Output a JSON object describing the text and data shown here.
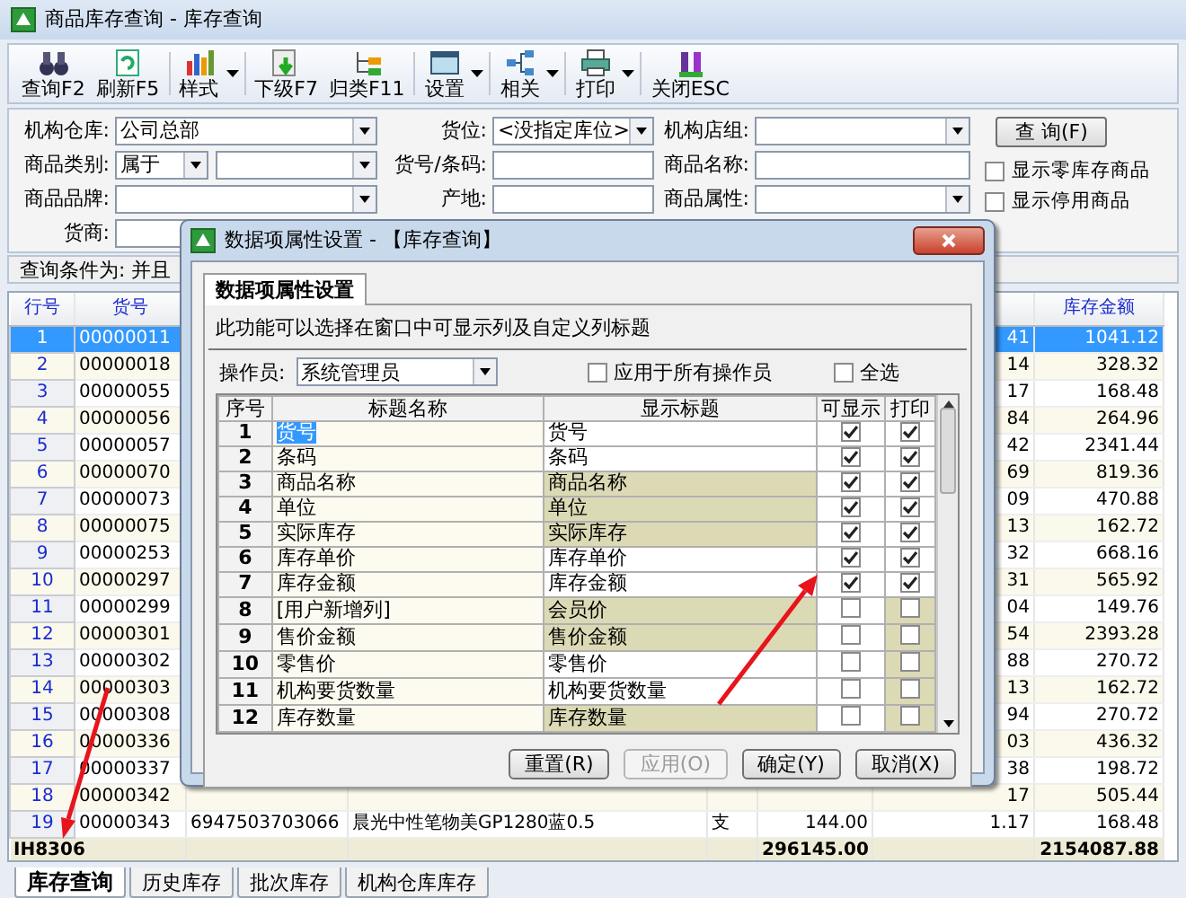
{
  "window": {
    "title": "商品库存查询 - 库存查询"
  },
  "toolbar": [
    {
      "label": "查询F2",
      "has_menu": false
    },
    {
      "label": "刷新F5",
      "has_menu": false
    },
    {
      "label": "样式",
      "has_menu": true
    },
    {
      "label": "下级F7",
      "has_menu": false
    },
    {
      "label": "归类F11",
      "has_menu": false
    },
    {
      "label": "设置",
      "has_menu": true
    },
    {
      "label": "相关",
      "has_menu": true
    },
    {
      "label": "打印",
      "has_menu": true
    },
    {
      "label": "关闭ESC",
      "has_menu": false
    }
  ],
  "filters": [
    {
      "label": "机构仓库:",
      "kind": "select",
      "value": "公司总部"
    },
    {
      "label": "货位:",
      "kind": "select",
      "value": "<没指定库位>"
    },
    {
      "label": "机构店组:",
      "kind": "select"
    },
    {
      "label": "商品类别:",
      "kind": "split",
      "value": "属于"
    },
    {
      "label": "货号/条码:",
      "kind": "input"
    },
    {
      "label": "商品名称:",
      "kind": "input"
    },
    {
      "label": "商品品牌:",
      "kind": "select"
    },
    {
      "label": "产地:",
      "kind": "input"
    },
    {
      "label": "商品属性:",
      "kind": "select"
    },
    {
      "label": "货商:",
      "kind": "lookup"
    }
  ],
  "query_button": "查 询(F)",
  "options": [
    {
      "label": "显示零库存商品",
      "checked": false
    },
    {
      "label": "显示停用商品",
      "checked": false
    }
  ],
  "condition": "查询条件为: 并且",
  "table": {
    "headers": {
      "row": "行号",
      "code": "货号",
      "amount": "库存金额"
    },
    "rows": [
      {
        "row": "1",
        "code": "00000011",
        "column_7": "41",
        "amount": "1041.12",
        "selected": true
      },
      {
        "row": "2",
        "code": "00000018",
        "column_7": "14",
        "amount": "328.32",
        "selected": false
      },
      {
        "row": "3",
        "code": "00000055",
        "column_7": "17",
        "amount": "168.48",
        "selected": false
      },
      {
        "row": "4",
        "code": "00000056",
        "column_7": "84",
        "amount": "264.96",
        "selected": false
      },
      {
        "row": "5",
        "code": "00000057",
        "column_7": "42",
        "amount": "2341.44",
        "selected": false
      },
      {
        "row": "6",
        "code": "00000070",
        "column_7": "69",
        "amount": "819.36",
        "selected": false
      },
      {
        "row": "7",
        "code": "00000073",
        "column_7": "09",
        "amount": "470.88",
        "selected": false
      },
      {
        "row": "8",
        "code": "00000075",
        "column_7": "13",
        "amount": "162.72",
        "selected": false
      },
      {
        "row": "9",
        "code": "00000253",
        "column_7": "32",
        "amount": "668.16",
        "selected": false
      },
      {
        "row": "10",
        "code": "00000297",
        "column_7": "31",
        "amount": "565.92",
        "selected": false
      },
      {
        "row": "11",
        "code": "00000299",
        "column_7": "04",
        "amount": "149.76",
        "selected": false
      },
      {
        "row": "12",
        "code": "00000301",
        "column_7": "54",
        "amount": "2393.28",
        "selected": false
      },
      {
        "row": "13",
        "code": "00000302",
        "column_7": "88",
        "amount": "270.72",
        "selected": false
      },
      {
        "row": "14",
        "code": "00000303",
        "column_7": "13",
        "amount": "162.72",
        "selected": false
      },
      {
        "row": "15",
        "code": "00000308",
        "column_7": "94",
        "amount": "270.72",
        "selected": false
      },
      {
        "row": "16",
        "code": "00000336",
        "column_7": "03",
        "amount": "436.32",
        "selected": false
      },
      {
        "row": "17",
        "code": "00000337",
        "column_7": "38",
        "amount": "198.72",
        "selected": false
      },
      {
        "row": "18",
        "code": "00000342",
        "column_7": "17",
        "amount": "505.44",
        "selected": false
      },
      {
        "row": "19",
        "code": "00000343",
        "barcode": "6947503703066",
        "name": "晨光中性笔物美GP1280蓝0.5",
        "unit": "支",
        "stock": "144.00",
        "column_7": "1.17",
        "amount": "168.48",
        "selected": false
      }
    ],
    "footer": {
      "label": "IH8306",
      "stock": "296145.00",
      "amount": "2154087.88"
    }
  },
  "bottom_tabs": [
    {
      "label": "库存查询",
      "selected": true
    },
    {
      "label": "历史库存",
      "selected": false
    },
    {
      "label": "批次库存",
      "selected": false
    },
    {
      "label": "机构仓库库存",
      "selected": false
    }
  ],
  "dialog": {
    "title": "数据项属性设置 - 【库存查询】",
    "tab": "数据项属性设置",
    "description": "此功能可以选择在窗口中可显示列及自定义列标题",
    "operator": {
      "label": "操作员:",
      "value": "系统管理员"
    },
    "options": [
      {
        "label": "应用于所有操作员",
        "checked": false
      },
      {
        "label": "全选",
        "checked": false
      }
    ],
    "columns": [
      "序号",
      "标题名称",
      "显示标题",
      "可显示",
      "打印"
    ],
    "rows": [
      {
        "index": "1",
        "title": "货号",
        "display": "货号",
        "visible": true,
        "print": true,
        "selected": true,
        "shaded": false
      },
      {
        "index": "2",
        "title": "条码",
        "display": "条码",
        "visible": true,
        "print": true,
        "selected": false,
        "shaded": false
      },
      {
        "index": "3",
        "title": "商品名称",
        "display": "商品名称",
        "visible": true,
        "print": true,
        "selected": false,
        "shaded": true
      },
      {
        "index": "4",
        "title": "单位",
        "display": "单位",
        "visible": true,
        "print": true,
        "selected": false,
        "shaded": true
      },
      {
        "index": "5",
        "title": "实际库存",
        "display": "实际库存",
        "visible": true,
        "print": true,
        "selected": false,
        "shaded": true
      },
      {
        "index": "6",
        "title": "库存单价",
        "display": "库存单价",
        "visible": true,
        "print": true,
        "selected": false,
        "shaded": false
      },
      {
        "index": "7",
        "title": "库存金额",
        "display": "库存金额",
        "visible": true,
        "print": true,
        "selected": false,
        "shaded": false
      },
      {
        "index": "8",
        "title": "[用户新增列]",
        "display": "会员价",
        "visible": false,
        "print": false,
        "selected": false,
        "shaded": true
      },
      {
        "index": "9",
        "title": "售价金额",
        "display": "售价金额",
        "visible": false,
        "print": false,
        "selected": false,
        "shaded": true
      },
      {
        "index": "10",
        "title": "零售价",
        "display": "零售价",
        "visible": false,
        "print": false,
        "selected": false,
        "shaded": false
      },
      {
        "index": "11",
        "title": "机构要货数量",
        "display": "机构要货数量",
        "visible": false,
        "print": false,
        "selected": false,
        "shaded": false
      },
      {
        "index": "12",
        "title": "库存数量",
        "display": "库存数量",
        "visible": false,
        "print": false,
        "selected": false,
        "shaded": true
      }
    ],
    "buttons": [
      {
        "label": "重置(R)",
        "disabled": false
      },
      {
        "label": "应用(O)",
        "disabled": true
      },
      {
        "label": "确定(Y)",
        "disabled": false
      },
      {
        "label": "取消(X)",
        "disabled": false
      }
    ]
  }
}
